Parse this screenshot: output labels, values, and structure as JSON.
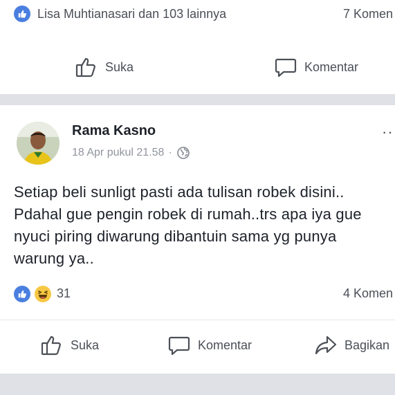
{
  "previous_post": {
    "reaction_names": "Lisa Muhtianasari dan 103 lainnya",
    "comment_count": "7 Komen",
    "actions": {
      "like": "Suka",
      "comment": "Komentar"
    }
  },
  "post": {
    "author": "Rama Kasno",
    "timestamp": "18 Apr pukul 21.58",
    "separator_dot": "·",
    "more_menu": "··",
    "text_lines": [
      "Setiap beli sunligt pasti ada tulisan robek disini..",
      "Pdahal gue pengin robek di rumah..trs apa iya gue",
      "nyuci piring diwarung dibantuin sama yg punya",
      "warung ya.."
    ],
    "reaction_count": "31",
    "comment_count": "4 Komen",
    "actions": {
      "like": "Suka",
      "comment": "Komentar",
      "share": "Bagikan"
    }
  },
  "colors": {
    "like_blue": "#4a7fe0",
    "haha_yellow": "#f7c844",
    "separator_gray": "#dfe1e6",
    "secondary_text": "#4b4f56"
  },
  "icons": [
    "like-badge-icon",
    "haha-badge-icon",
    "thumbs-up-icon",
    "comment-bubble-icon",
    "share-arrow-icon",
    "globe-icon"
  ]
}
